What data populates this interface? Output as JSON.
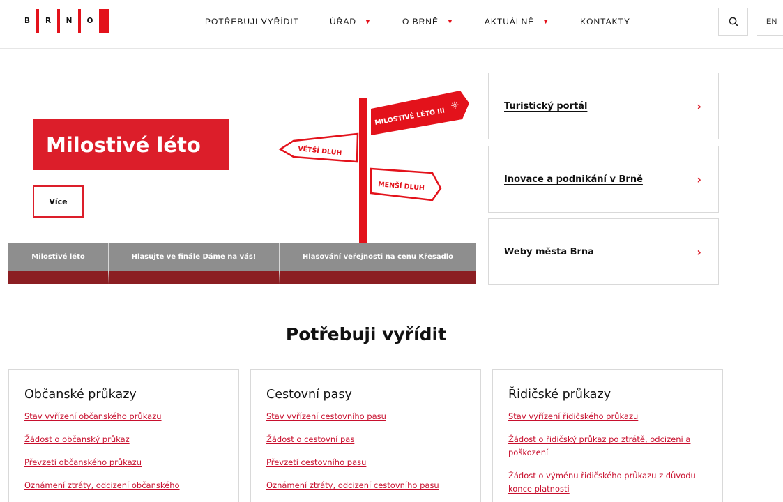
{
  "logo": {
    "letters": [
      "B",
      "R",
      "N",
      "O"
    ],
    "brand_color": "#e3121b"
  },
  "nav": [
    {
      "label": "POTŘEBUJI VYŘÍDIT",
      "has_dropdown": false
    },
    {
      "label": "ÚŘAD",
      "has_dropdown": true
    },
    {
      "label": "O BRNĚ",
      "has_dropdown": true
    },
    {
      "label": "AKTUÁLNĚ",
      "has_dropdown": true
    },
    {
      "label": "KONTAKTY",
      "has_dropdown": false
    }
  ],
  "header": {
    "search_icon": "search-icon",
    "lang": "EN"
  },
  "hero": {
    "title": "Milostivé léto",
    "button": "Více",
    "signs": {
      "top": "MILOSTIVÉ LÉTO III",
      "left": "VĚTŠÍ DLUH",
      "right": "MENŠÍ DLUH"
    },
    "tabs": [
      {
        "label": "Milostivé léto"
      },
      {
        "label": "Hlasujte ve finále Dáme na vás!"
      },
      {
        "label": "Hlasování veřejnosti na cenu Křesadlo"
      }
    ]
  },
  "quick_links": [
    {
      "label": "Turistický portál"
    },
    {
      "label": "Inovace a podnikání v Brně"
    },
    {
      "label": "Weby města Brna"
    }
  ],
  "section": {
    "title": "Potřebuji vyřídit",
    "cards": [
      {
        "title": "Občanské průkazy",
        "links": [
          "Stav vyřízení občanského průkazu",
          "Žádost o občanský průkaz",
          "Převzetí občanského průkazu",
          "Oznámení ztráty, odcizení občanského"
        ]
      },
      {
        "title": "Cestovní pasy",
        "links": [
          "Stav vyřízení cestovního pasu",
          "Žádost o cestovní pas",
          "Převzetí cestovního pasu",
          "Oznámení ztráty, odcizení cestovního pasu"
        ]
      },
      {
        "title": "Řidičské průkazy",
        "links": [
          "Stav vyřízení řidičského průkazu",
          "Žádost o řidičský průkaz po ztrátě, odcizení a poškození",
          "Žádost o výměnu řidičského průkazu z důvodu konce platnosti"
        ]
      }
    ]
  },
  "colors": {
    "accent": "#dc1e2a",
    "tab_bg": "#8e8e8e",
    "tab_bottom": "#8b1e22",
    "link": "#c8102e"
  }
}
